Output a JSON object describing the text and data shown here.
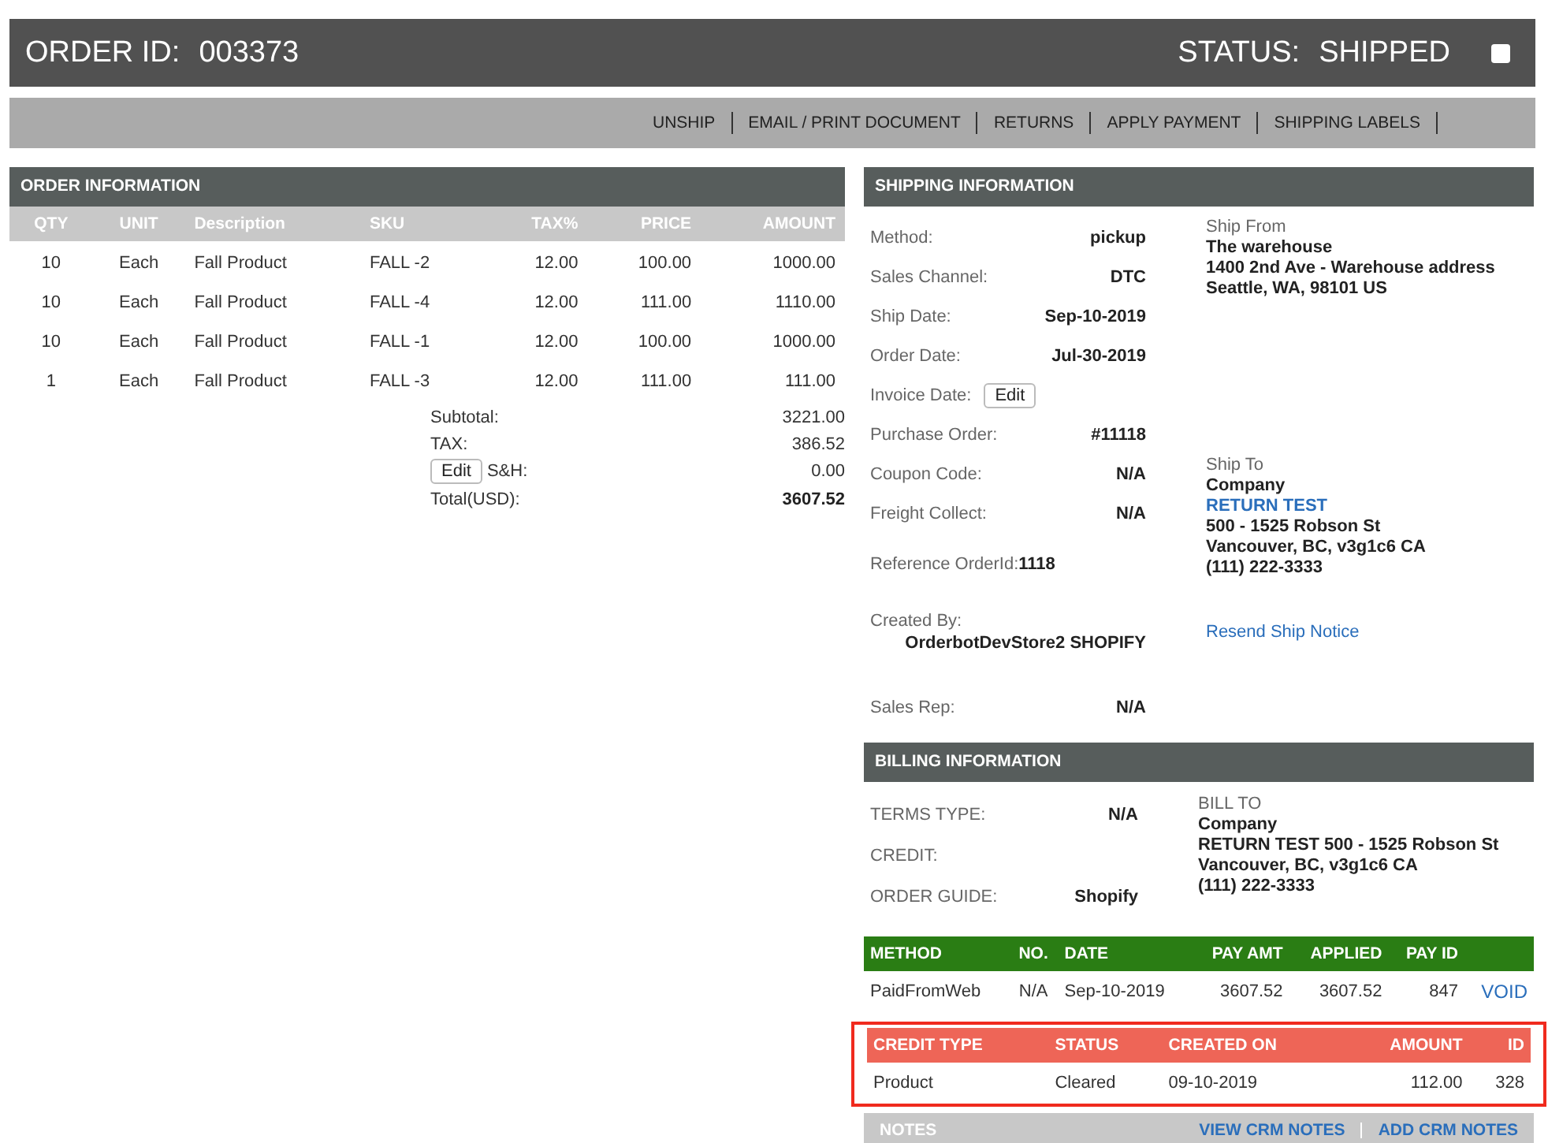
{
  "header": {
    "order_label": "ORDER ID:",
    "order_id": "003373",
    "status_label": "STATUS:",
    "status": "SHIPPED",
    "checkbox": {
      "checked": false
    }
  },
  "actions": [
    "UNSHIP",
    "EMAIL / PRINT DOCUMENT",
    "RETURNS",
    "APPLY PAYMENT",
    "SHIPPING LABELS"
  ],
  "order_info": {
    "title": "ORDER INFORMATION",
    "columns": [
      "QTY",
      "UNIT",
      "Description",
      "SKU",
      "TAX%",
      "PRICE",
      "AMOUNT"
    ],
    "rows": [
      [
        "10",
        "Each",
        "Fall Product",
        "FALL -2",
        "12.00",
        "100.00",
        "1000.00"
      ],
      [
        "10",
        "Each",
        "Fall Product",
        "FALL -4",
        "12.00",
        "111.00",
        "1110.00"
      ],
      [
        "10",
        "Each",
        "Fall Product",
        "FALL -1",
        "12.00",
        "100.00",
        "1000.00"
      ],
      [
        "1",
        "Each",
        "Fall Product",
        "FALL -3",
        "12.00",
        "111.00",
        "111.00"
      ]
    ],
    "totals": [
      {
        "kind": "plain",
        "label": "Subtotal:",
        "value": "3221.00"
      },
      {
        "kind": "plain",
        "label": "TAX:",
        "value": "386.52"
      },
      {
        "kind": "edit",
        "button": "Edit",
        "label": "S&H:",
        "value": "0.00"
      },
      {
        "kind": "total",
        "label": "Total(USD):",
        "value": "3607.52"
      }
    ]
  },
  "shipping": {
    "title": "SHIPPING INFORMATION",
    "fields": [
      {
        "kind": "inline",
        "label": "Method:",
        "value": "pickup"
      },
      {
        "kind": "inline",
        "label": "Sales Channel:",
        "value": "DTC"
      },
      {
        "kind": "inline",
        "label": "Ship Date:",
        "value": "Sep-10-2019"
      },
      {
        "kind": "inline",
        "label": "Order Date:",
        "value": "Jul-30-2019"
      },
      {
        "kind": "edit",
        "label": "Invoice Date:",
        "value": "Edit"
      },
      {
        "kind": "inline",
        "label": "Purchase Order:",
        "value": "#11118"
      },
      {
        "kind": "inline",
        "label": "Coupon Code:",
        "value": "N/A"
      },
      {
        "kind": "inline",
        "label": "Freight Collect:",
        "value": "N/A"
      },
      {
        "kind": "joined",
        "label": "Reference OrderId:",
        "value": "1118"
      },
      {
        "kind": "stacked",
        "label": "Created By:",
        "value": "OrderbotDevStore2 SHOPIFY"
      },
      {
        "kind": "inline",
        "label": "Sales Rep:",
        "value": "N/A"
      }
    ],
    "ship_from": {
      "label": "Ship From",
      "lines": [
        "The warehouse",
        "1400 2nd Ave - Warehouse address",
        "Seattle, WA, 98101 US"
      ]
    },
    "ship_to": {
      "label": "Ship To",
      "company": "Company",
      "link": "RETURN TEST",
      "lines": [
        "500 - 1525 Robson St",
        "Vancouver, BC, v3g1c6 CA",
        "(111) 222-3333"
      ]
    },
    "resend_link": "Resend Ship Notice"
  },
  "billing": {
    "title": "BILLING INFORMATION",
    "fields": [
      {
        "label": "TERMS TYPE:",
        "value": "N/A"
      },
      {
        "label": "CREDIT:"
      },
      {
        "label": "ORDER GUIDE:",
        "value": "Shopify"
      }
    ],
    "bill_to": {
      "label": "BILL TO",
      "lines": [
        "Company",
        "RETURN TEST 500 - 1525 Robson St",
        "Vancouver, BC, v3g1c6 CA",
        "(111) 222-3333"
      ]
    }
  },
  "payments": {
    "columns": [
      "METHOD",
      "NO.",
      "DATE",
      "PAY AMT",
      "APPLIED",
      "PAY ID"
    ],
    "rows": [
      {
        "cells": [
          "PaidFromWeb",
          "N/A",
          "Sep-10-2019",
          "3607.52",
          "3607.52",
          "847"
        ],
        "action": "VOID"
      }
    ]
  },
  "credits": {
    "highlighted": true,
    "columns": [
      "CREDIT TYPE",
      "STATUS",
      "CREATED ON",
      "AMOUNT",
      "ID"
    ],
    "rows": [
      [
        "Product",
        "Cleared",
        "09-10-2019",
        "112.00",
        "328"
      ]
    ]
  },
  "notes": {
    "title": "NOTES",
    "links": [
      "VIEW CRM NOTES",
      "ADD CRM NOTES"
    ]
  }
}
